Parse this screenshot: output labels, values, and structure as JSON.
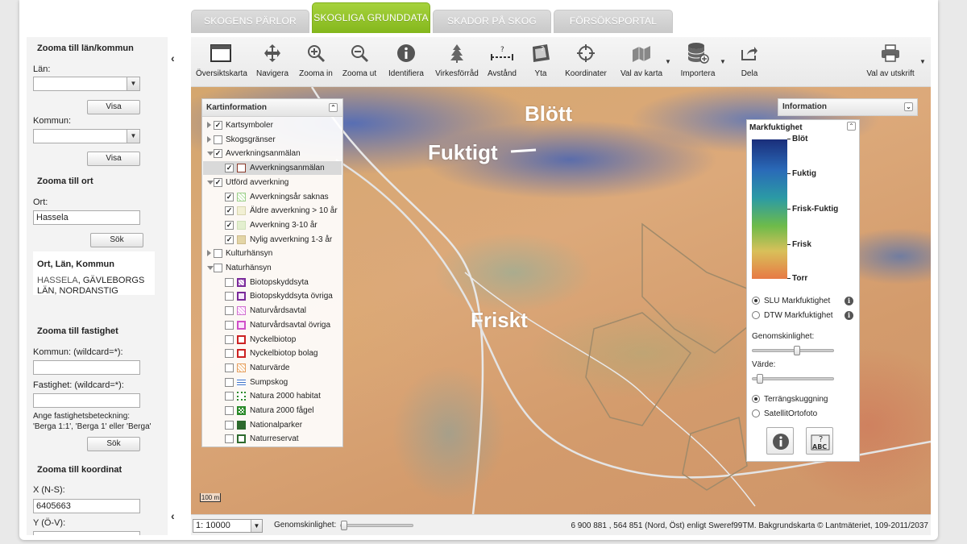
{
  "tabs": [
    {
      "label": "SKOGENS PÄRLOR",
      "active": false
    },
    {
      "label": "SKOGLIGA GRUNDDATA",
      "active": true
    },
    {
      "label": "SKADOR PÅ SKOG",
      "active": false
    },
    {
      "label": "FÖRSÖKSPORTAL",
      "active": false
    }
  ],
  "sidebar": {
    "zoom_lan_title": "Zooma till län/kommun",
    "lan_label": "Län:",
    "lan_value": "",
    "visa1": "Visa",
    "kommun_label": "Kommun:",
    "kommun_value": "",
    "visa2": "Visa",
    "zoom_ort_title": "Zooma till ort",
    "ort_label": "Ort:",
    "ort_value": "Hassela",
    "sok1": "Sök",
    "result_title": "Ort, Län, Kommun",
    "result_link": "HASSELA",
    "result_rest": ", GÄVLEBORGS LÄN, NORDANSTIG",
    "zoom_fastighet_title": "Zooma till fastighet",
    "kommun_wild_label": "Kommun: (wildcard=*):",
    "kommun_wild_value": "",
    "fastighet_wild_label": "Fastighet: (wildcard=*):",
    "fastighet_wild_value": "",
    "hint_line1": "Ange fastighetsbeteckning:",
    "hint_line2": "'Berga 1:1', 'Berga 1' eller 'Berga'",
    "sok2": "Sök",
    "zoom_koordinat_title": "Zooma till koordinat",
    "x_label": "X (N-S):",
    "x_value": "6405663",
    "y_label": "Y (Ö-V):",
    "y_value": ""
  },
  "toolbar": {
    "items": [
      {
        "label": "Översiktskarta",
        "icon": "overview-map-icon"
      },
      {
        "label": "Navigera",
        "icon": "move-icon"
      },
      {
        "label": "Zooma in",
        "icon": "zoom-in-icon"
      },
      {
        "label": "Zooma ut",
        "icon": "zoom-out-icon"
      },
      {
        "label": "Identifiera",
        "icon": "info-icon"
      },
      {
        "label": "Virkesförråd",
        "icon": "tree-icon"
      },
      {
        "label": "Avstånd",
        "icon": "distance-icon"
      },
      {
        "label": "Yta",
        "icon": "area-icon"
      },
      {
        "label": "Koordinater",
        "icon": "crosshair-icon"
      },
      {
        "label": "Val av karta",
        "icon": "map-select-icon"
      },
      {
        "label": "Importera",
        "icon": "database-import-icon"
      },
      {
        "label": "Dela",
        "icon": "share-icon"
      },
      {
        "label": "Val av utskrift",
        "icon": "printer-icon"
      }
    ]
  },
  "map": {
    "label_blott": "Blött",
    "label_fuktigt": "Fuktigt",
    "label_friskt": "Friskt",
    "scale_bar": "100 m"
  },
  "kartinformation": {
    "title": "Kartinformation",
    "rows": [
      {
        "label": "Kartsymboler",
        "checked": true
      },
      {
        "label": "Skogsgränser",
        "checked": false
      },
      {
        "label": "Avverkningsanmälan",
        "checked": true
      },
      {
        "label": "Avverkningsanmälan",
        "checked": true
      },
      {
        "label": "Utförd avverkning",
        "checked": true
      },
      {
        "label": "Avverkningsår saknas",
        "checked": true
      },
      {
        "label": "Äldre avverkning > 10 år",
        "checked": true
      },
      {
        "label": "Avverkning 3-10 år",
        "checked": true
      },
      {
        "label": "Nylig avverkning 1-3 år",
        "checked": true
      },
      {
        "label": "Kulturhänsyn",
        "checked": false
      },
      {
        "label": "Naturhänsyn",
        "checked": false
      },
      {
        "label": "Biotopskyddsyta",
        "checked": false
      },
      {
        "label": "Biotopskyddsyta övriga",
        "checked": false
      },
      {
        "label": "Naturvårdsavtal",
        "checked": false
      },
      {
        "label": "Naturvårdsavtal övriga",
        "checked": false
      },
      {
        "label": "Nyckelbiotop",
        "checked": false
      },
      {
        "label": "Nyckelbiotop bolag",
        "checked": false
      },
      {
        "label": "Naturvärde",
        "checked": false
      },
      {
        "label": "Sumpskog",
        "checked": false
      },
      {
        "label": "Natura 2000 habitat",
        "checked": false
      },
      {
        "label": "Natura 2000 fågel",
        "checked": false
      },
      {
        "label": "Nationalparker",
        "checked": false
      },
      {
        "label": "Naturreservat",
        "checked": false
      }
    ]
  },
  "information": {
    "title": "Information",
    "legend_title": "Markfuktighet",
    "ramp_labels": [
      "Blöt",
      "Fuktig",
      "Frisk-Fuktig",
      "Frisk",
      "Torr"
    ],
    "radio_slu": "SLU Markfuktighet",
    "radio_dtw": "DTW Markfuktighet",
    "transparency_label": "Genomskinlighet:",
    "transparency_value": 0.55,
    "value_label": "Värde:",
    "value_value": 0.05,
    "radio_terrain": "Terrängskuggning",
    "radio_satellite": "SatellitOrtofoto"
  },
  "bottombar": {
    "scale": "1: 10000",
    "transparency_label": "Genomskinlighet:",
    "transparency_value": 0.0,
    "coords": "6 900 881 , 564 851 (Nord, Öst) enligt Sweref99TM. Bakgrundskarta © Lantmäteriet, 109-2011/2037"
  },
  "colors": {
    "active_tab": "#8cbf24",
    "inactive_tab": "#d2d2d2",
    "ramp_wet": "#1a2e7a",
    "ramp_dry": "#e77a45"
  }
}
